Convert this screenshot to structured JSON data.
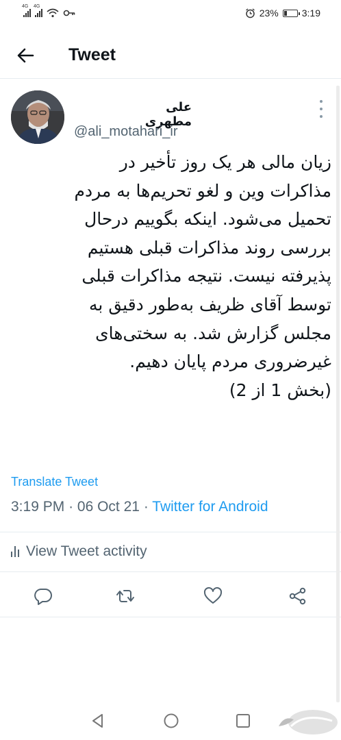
{
  "status_bar": {
    "signal_labels": [
      "4G",
      "4G"
    ],
    "battery": "23%",
    "time": "3:19"
  },
  "header": {
    "back_icon": "arrow-left-icon",
    "title": "Tweet"
  },
  "author": {
    "name": "علی مطهری",
    "handle": "@ali_motahari_ir"
  },
  "tweet": {
    "lines": [
      "زیان مالی هر یک روز تأخیر در",
      "مذاکرات وین و لغو تحریم‌ها به مردم",
      "تحمیل می‌شود. اینکه بگوییم درحال",
      "بررسی روند مذاکرات قبلی هستیم",
      "پذیرفته نیست. نتیجه مذاکرات قبلی",
      "توسط آقای ظریف به‌طور دقیق به",
      "مجلس گزارش شد. به سختی‌های",
      "غیرضروری مردم پایان دهیم.",
      "(بخش 1 از 2)"
    ],
    "translate_label": "Translate Tweet",
    "time": "3:19 PM",
    "separator": "·",
    "date": "06 Oct 21",
    "source": "Twitter for Android"
  },
  "activity": {
    "label": "View Tweet activity"
  },
  "actions": {
    "icons": [
      "reply-icon",
      "retweet-icon",
      "like-icon",
      "share-icon"
    ]
  },
  "navbar": {
    "icons": [
      "back-triangle-icon",
      "home-circle-icon",
      "recents-square-icon"
    ]
  },
  "colors": {
    "accent": "#1d9bf0",
    "text": "#0f1419",
    "secondary": "#536471",
    "divider": "#e6ecf0"
  }
}
